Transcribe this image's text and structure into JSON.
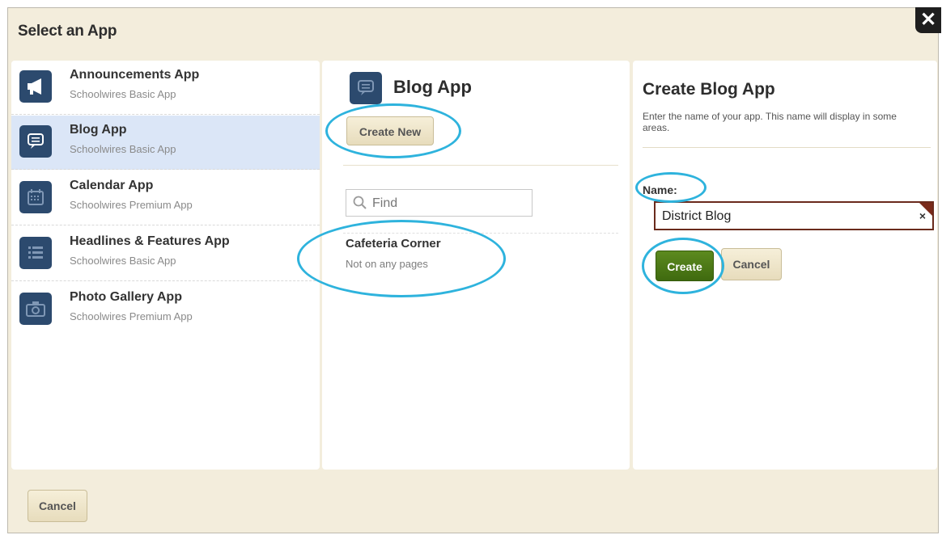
{
  "dialog": {
    "title": "Select an App",
    "close_glyph": "✕"
  },
  "apps": [
    {
      "name": "Announcements App",
      "subtitle": "Schoolwires Basic App",
      "icon": "megaphone-icon",
      "selected": false
    },
    {
      "name": "Blog App",
      "subtitle": "Schoolwires Basic App",
      "icon": "speech-bubble-icon",
      "selected": true
    },
    {
      "name": "Calendar App",
      "subtitle": "Schoolwires Premium App",
      "icon": "calendar-icon",
      "selected": false
    },
    {
      "name": "Headlines & Features App",
      "subtitle": "Schoolwires Basic App",
      "icon": "list-icon",
      "selected": false
    },
    {
      "name": "Photo Gallery App",
      "subtitle": "Schoolwires Premium App",
      "icon": "camera-icon",
      "selected": false
    }
  ],
  "middle": {
    "title": "Blog App",
    "create_new_label": "Create New",
    "find_placeholder": "Find",
    "instances": [
      {
        "name": "Cafeteria Corner",
        "status": "Not on any pages"
      }
    ]
  },
  "create_form": {
    "title": "Create Blog App",
    "description": "Enter the name of your app. This name will display in some areas.",
    "name_label": "Name:",
    "name_value": "District Blog",
    "clear_glyph": "×",
    "create_label": "Create",
    "cancel_label": "Cancel"
  },
  "footer": {
    "cancel_label": "Cancel"
  },
  "colors": {
    "dialog_bg": "#f3eddc",
    "selected_bg": "#dbe6f7",
    "icon_bg": "#2c4a6e",
    "create_green": "#4a7a14",
    "highlight_ring": "#2eb3dd"
  }
}
